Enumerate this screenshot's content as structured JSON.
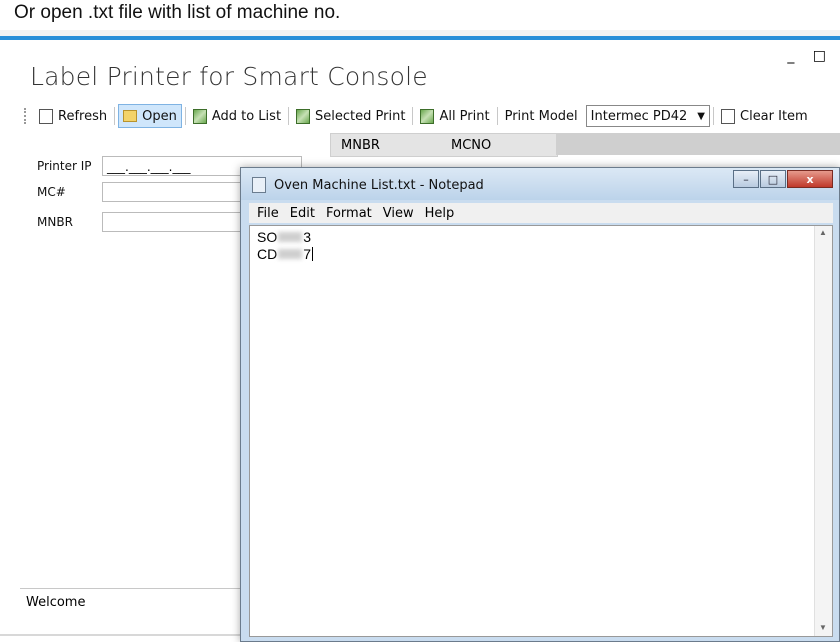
{
  "caption": "Or open .txt file with list of machine no.",
  "app": {
    "title": "Label Printer for Smart Console",
    "window_controls": {
      "minimize": "_",
      "maximize": "□"
    }
  },
  "toolbar": {
    "refresh": "Refresh",
    "open": "Open",
    "add_to_list": "Add to List",
    "selected_print": "Selected Print",
    "all_print": "All Print",
    "print_model_label": "Print Model",
    "print_model_value": "Intermec PD42",
    "clear_item": "Clear Item"
  },
  "form": {
    "printer_ip_label": "Printer IP",
    "printer_ip_value": "___.___.___.___",
    "mc_label": "MC#",
    "mnbr_label": "MNBR"
  },
  "grid": {
    "columns": [
      "MNBR",
      "MCNO"
    ]
  },
  "status": {
    "welcome": "Welcome"
  },
  "notepad": {
    "title": "Oven Machine List.txt - Notepad",
    "menu": [
      "File",
      "Edit",
      "Format",
      "View",
      "Help"
    ],
    "lines": [
      {
        "prefix": "SO",
        "suffix": "3"
      },
      {
        "prefix": "CD",
        "suffix": "7"
      }
    ],
    "buttons": {
      "minimize": "–",
      "maximize": "□",
      "close": "x"
    }
  }
}
